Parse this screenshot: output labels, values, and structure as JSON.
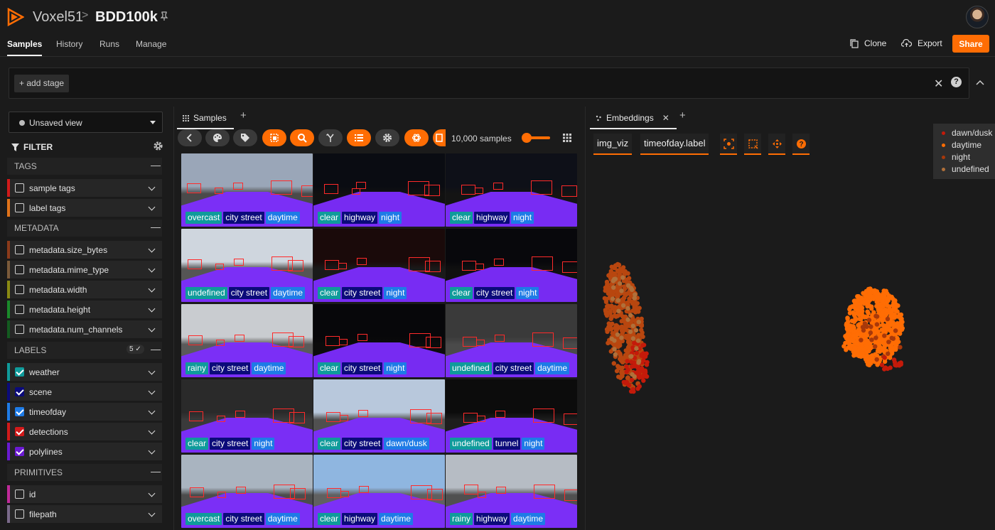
{
  "header": {
    "brand": "Voxel51",
    "separator": ">",
    "dataset": "BDD100k",
    "nav_tabs": [
      "Samples",
      "History",
      "Runs",
      "Manage"
    ],
    "clone_label": "Clone",
    "export_label": "Export",
    "share_label": "Share"
  },
  "viewbar": {
    "add_stage_label": "+ add stage",
    "clear_label": "✕",
    "help_label": "?"
  },
  "sidebar": {
    "view_selector": "Unsaved view",
    "filter_title": "FILTER",
    "sections": {
      "tags": "TAGS",
      "metadata": "METADATA",
      "labels": "LABELS",
      "labels_count": "5 ✓",
      "primitives": "PRIMITIVES"
    },
    "tag_rows": [
      {
        "label": "sample tags",
        "color": "#d11a1a"
      },
      {
        "label": "label tags",
        "color": "#e0731a"
      }
    ],
    "metadata_rows": [
      {
        "label": "metadata.size_bytes",
        "color": "#8b3a1a"
      },
      {
        "label": "metadata.mime_type",
        "color": "#7a5a3a"
      },
      {
        "label": "metadata.width",
        "color": "#8a8a12"
      },
      {
        "label": "metadata.height",
        "color": "#1a8a2a"
      },
      {
        "label": "metadata.num_channels",
        "color": "#135a20"
      }
    ],
    "label_rows": [
      {
        "label": "weather",
        "color": "#0f9b9b",
        "checked": true
      },
      {
        "label": "scene",
        "color": "#0b0b7a",
        "checked": true
      },
      {
        "label": "timeofday",
        "color": "#1e7be6",
        "checked": true
      },
      {
        "label": "detections",
        "color": "#d11a1a",
        "checked": true
      },
      {
        "label": "polylines",
        "color": "#6a1ad1",
        "checked": true
      }
    ],
    "primitive_rows": [
      {
        "label": "id",
        "color": "#c02a9a"
      },
      {
        "label": "filepath",
        "color": "#7a6a8a"
      }
    ]
  },
  "samples_panel": {
    "tab_label": "Samples",
    "sample_count": "10,000 samples",
    "tiles": [
      {
        "weather": "overcast",
        "scene": "city street",
        "time": "daytime",
        "sky": "#9aa6b8",
        "ground": "#4a4a4a"
      },
      {
        "weather": "clear",
        "scene": "highway",
        "time": "night",
        "sky": "#0a0c12",
        "ground": "#111"
      },
      {
        "weather": "clear",
        "scene": "highway",
        "time": "night",
        "sky": "#0e1018",
        "ground": "#141414"
      },
      {
        "weather": "undefined",
        "scene": "city street",
        "time": "daytime",
        "sky": "#cfd6de",
        "ground": "#555"
      },
      {
        "weather": "clear",
        "scene": "city street",
        "time": "night",
        "sky": "#1a0a0a",
        "ground": "#1a1a1a"
      },
      {
        "weather": "clear",
        "scene": "city street",
        "time": "night",
        "sky": "#08080c",
        "ground": "#101010"
      },
      {
        "weather": "rainy",
        "scene": "city street",
        "time": "daytime",
        "sky": "#c9ccd0",
        "ground": "#5a5a5a"
      },
      {
        "weather": "clear",
        "scene": "city street",
        "time": "night",
        "sky": "#07070a",
        "ground": "#0c0c0c"
      },
      {
        "weather": "undefined",
        "scene": "city street",
        "time": "daytime",
        "sky": "#3a3a3a",
        "ground": "#4a4a4a"
      },
      {
        "weather": "clear",
        "scene": "city street",
        "time": "night",
        "sky": "#2a2a2a",
        "ground": "#3a3a3a"
      },
      {
        "weather": "clear",
        "scene": "city street",
        "time": "dawn/dusk",
        "sky": "#b8c8dc",
        "ground": "#505050"
      },
      {
        "weather": "undefined",
        "scene": "tunnel",
        "time": "night",
        "sky": "#0c0c0c",
        "ground": "#1e1e1e"
      },
      {
        "weather": "overcast",
        "scene": "city street",
        "time": "daytime",
        "sky": "#a9b4c0",
        "ground": "#4c4c4c"
      },
      {
        "weather": "clear",
        "scene": "highway",
        "time": "daytime",
        "sky": "#8fb6e0",
        "ground": "#606060"
      },
      {
        "weather": "rainy",
        "scene": "highway",
        "time": "daytime",
        "sky": "#b6bcc4",
        "ground": "#505050"
      }
    ]
  },
  "embeddings_panel": {
    "tab_label": "Embeddings",
    "brain_key": "img_viz",
    "color_by": "timeofday.label",
    "legend": [
      {
        "label": "dawn/dusk",
        "color": "#c41a0a"
      },
      {
        "label": "daytime",
        "color": "#ff6d04"
      },
      {
        "label": "night",
        "color": "#a8380a"
      },
      {
        "label": "undefined",
        "color": "#b0703a"
      }
    ],
    "colors": {
      "left_cluster": "#b8460f",
      "right_cluster": "#ff6d04",
      "accent": "#ff6d04"
    }
  }
}
